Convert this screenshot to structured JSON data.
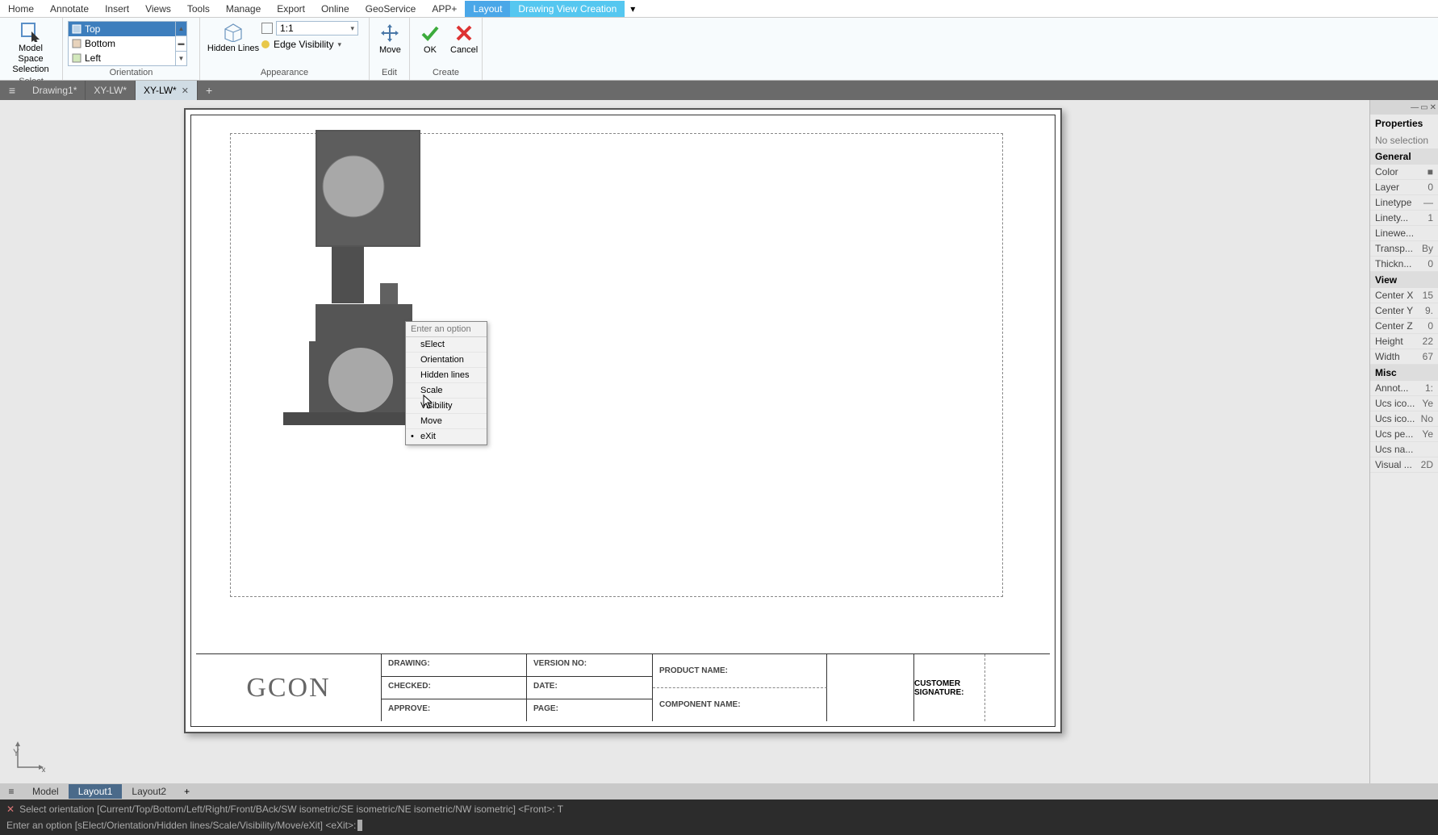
{
  "menu": {
    "items": [
      "Home",
      "Annotate",
      "Insert",
      "Views",
      "Tools",
      "Manage",
      "Export",
      "Online",
      "GeoService",
      "APP+",
      "Layout",
      "Drawing View Creation"
    ],
    "active": 10,
    "active2": 11
  },
  "ribbon": {
    "select": {
      "big": "Model Space\nSelection",
      "label": "Select"
    },
    "orientation": {
      "rows": [
        "Top",
        "Bottom",
        "Left"
      ],
      "sel": 0,
      "label": "Orientation"
    },
    "appearance": {
      "big": "Hidden Lines",
      "scale": "1:1",
      "edge": "Edge Visibility",
      "label": "Appearance"
    },
    "edit": {
      "move": "Move",
      "label": "Edit"
    },
    "create": {
      "ok": "OK",
      "cancel": "Cancel",
      "label": "Create"
    }
  },
  "tabs": {
    "items": [
      "Drawing1*",
      "XY-LW*",
      "XY-LW*"
    ],
    "active": 2
  },
  "context": {
    "header": "Enter an option",
    "items": [
      "sElect",
      "Orientation",
      "Hidden lines",
      "Scale",
      "Visibility",
      "Move",
      "eXit"
    ],
    "default": 6
  },
  "titleblock": {
    "logo": "GCON",
    "c1": [
      "DRAWING:",
      "CHECKED:",
      "APPROVE:"
    ],
    "c2": [
      "VERSION NO:",
      "DATE:",
      "PAGE:"
    ],
    "c3": [
      "PRODUCT NAME:",
      "COMPONENT NAME:"
    ],
    "c5": "CUSTOMER SIGNATURE:"
  },
  "props": {
    "title": "Properties",
    "sub": "No selection",
    "general": {
      "label": "General",
      "rows": [
        [
          "Color",
          "■"
        ],
        [
          "Layer",
          "0"
        ],
        [
          "Linetype",
          "—"
        ],
        [
          "Linety...",
          "1"
        ],
        [
          "Linewe...",
          ""
        ],
        [
          "Transp...",
          "By"
        ],
        [
          "Thickn...",
          "0"
        ]
      ]
    },
    "view": {
      "label": "View",
      "rows": [
        [
          "Center X",
          "15"
        ],
        [
          "Center Y",
          "9."
        ],
        [
          "Center Z",
          "0"
        ],
        [
          "Height",
          "22"
        ],
        [
          "Width",
          "67"
        ]
      ]
    },
    "misc": {
      "label": "Misc",
      "rows": [
        [
          "Annot...",
          "1:"
        ],
        [
          "Ucs ico...",
          "Ye"
        ],
        [
          "Ucs ico...",
          "No"
        ],
        [
          "Ucs pe...",
          "Ye"
        ],
        [
          "Ucs na...",
          ""
        ],
        [
          "Visual ...",
          "2D"
        ]
      ]
    }
  },
  "layouts": {
    "items": [
      "Model",
      "Layout1",
      "Layout2"
    ],
    "active": 1
  },
  "cmd": {
    "l1": "Select orientation [Current/Top/Bottom/Left/Right/Front/BAck/SW isometric/SE isometric/NE isometric/NW isometric] <Front>: T",
    "l2": "Enter an option [sElect/Orientation/Hidden lines/Scale/Visibility/Move/eXit] <eXit>: "
  }
}
